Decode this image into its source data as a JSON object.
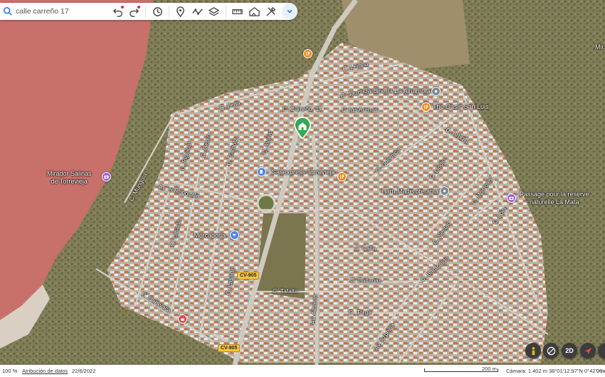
{
  "toolbar": {
    "search_value": "calle carreño 17",
    "buttons": [
      "undo-icon",
      "redo-icon",
      "history-icon",
      "pin-icon",
      "path-icon",
      "layers-icon",
      "ruler-icon",
      "image-icon",
      "tools-icon",
      "chevron-down-icon"
    ]
  },
  "streets": {
    "lejona": "C. Lejona",
    "jaime": "C. Jaume",
    "las_arenas": "C. las Arenas",
    "lena": "C. Lena",
    "carreno": "C. Carreño, 17",
    "arbizu": "C. Arbizu",
    "guernica": "C. Guernica",
    "llodio": "C. Llodio",
    "zarautz": "C. Zarautz",
    "ayalar": "C. Ayalar",
    "munguia": "C. Munguia",
    "ronquillo": "Av. el Ronquillo",
    "mostoles": "C. Mostoles",
    "sestao": "C. Sestao",
    "elgoibar": "C. Elgoibar",
    "lasarte": "C. Lasarte",
    "getxo": "C. Getxo",
    "loiu": "C. Loiu",
    "calla": "C. Calla",
    "baltanas": "C. Baltanas",
    "barakaldo": "C. Baracaldo",
    "torga": "C. Torga",
    "tafalla": "C. Tafalla",
    "caravaca": "C. Caravaca",
    "albanto": "Av. Albanto",
    "azpeitia": "Av. Azpeitia",
    "cv905": "CV-905",
    "cv905b": "CV-905"
  },
  "pois": {
    "mirador": "Mirador Salinas\nde Torrevieja",
    "jardineria": "Jardinería La Alhambra",
    "oasis": "The Oasis San Luis",
    "gasexpress": "Gasexpress Torrevieja",
    "haru": "Haru Maderoterapia",
    "passage": "Passage pour la réserve\nnaturelle La Mata",
    "mercadona": "Mercadona",
    "mir_edge": "Mir"
  },
  "colors": {
    "lagoon": "#c8706a",
    "pin_orange": "#f28b1d",
    "pin_purple": "#a25ddc",
    "pin_blue": "#4a86e8",
    "pin_grey": "#7a8a96",
    "pin_red": "#e04a4a",
    "home_pin": "#34a853"
  },
  "controls": [
    "street-view-icon",
    "compass-icon",
    "2D",
    "navigate-icon"
  ],
  "status": {
    "zoom": "100 %",
    "attribution": "Atribución de datos",
    "date": "22/6/2022",
    "scale": "200 m",
    "camera": "Cámara: 1.402 m",
    "coords": "38°01'12.97\"N 0°42'06.48\"O",
    "elevation": "0 m"
  }
}
